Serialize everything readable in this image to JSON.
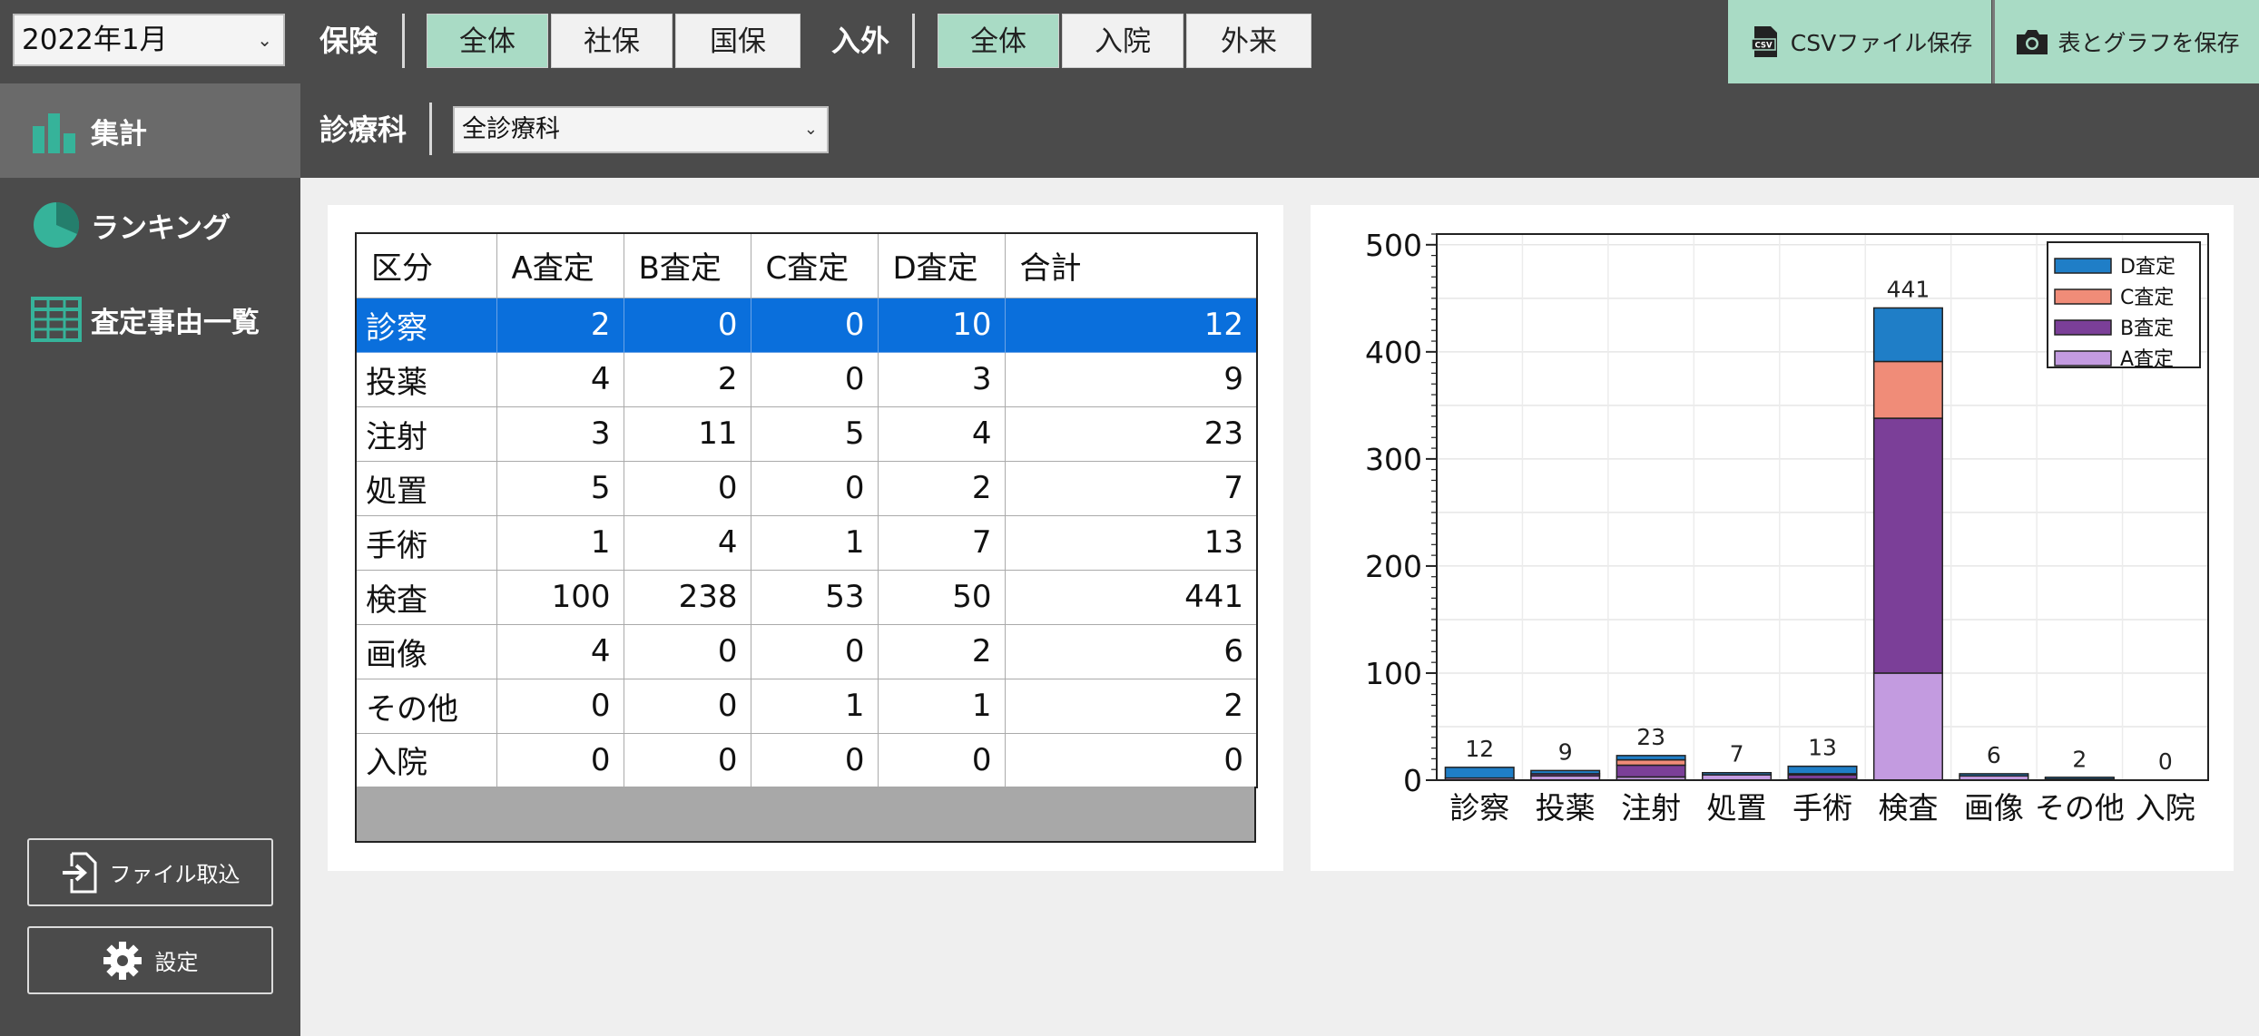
{
  "toolbar": {
    "month_value": "2022年1月",
    "insurance_label": "保険",
    "insurance_options": [
      "全体",
      "社保",
      "国保"
    ],
    "inout_label": "入外",
    "inout_options": [
      "全体",
      "入院",
      "外来"
    ],
    "csv_save_label": "CSVファイル保存",
    "csv_icon_text": "CSV",
    "save_table_graph_label": "表とグラフを保存"
  },
  "filter": {
    "dept_label": "診療科",
    "dept_value": "全診療科"
  },
  "sidebar": {
    "items": [
      {
        "label": "集計"
      },
      {
        "label": "ランキング"
      },
      {
        "label": "査定事由一覧"
      }
    ],
    "import_label": "ファイル取込",
    "settings_label": "設定"
  },
  "table": {
    "headers": [
      "区分",
      "A査定",
      "B査定",
      "C査定",
      "D査定",
      "合計"
    ],
    "rows": [
      {
        "cat": "診察",
        "a": "2",
        "b": "0",
        "c": "0",
        "d": "10",
        "total": "12"
      },
      {
        "cat": "投薬",
        "a": "4",
        "b": "2",
        "c": "0",
        "d": "3",
        "total": "9"
      },
      {
        "cat": "注射",
        "a": "3",
        "b": "11",
        "c": "5",
        "d": "4",
        "total": "23"
      },
      {
        "cat": "処置",
        "a": "5",
        "b": "0",
        "c": "0",
        "d": "2",
        "total": "7"
      },
      {
        "cat": "手術",
        "a": "1",
        "b": "4",
        "c": "1",
        "d": "7",
        "total": "13"
      },
      {
        "cat": "検査",
        "a": "100",
        "b": "238",
        "c": "53",
        "d": "50",
        "total": "441"
      },
      {
        "cat": "画像",
        "a": "4",
        "b": "0",
        "c": "0",
        "d": "2",
        "total": "6"
      },
      {
        "cat": "その他",
        "a": "0",
        "b": "0",
        "c": "1",
        "d": "1",
        "total": "2"
      },
      {
        "cat": "入院",
        "a": "0",
        "b": "0",
        "c": "0",
        "d": "0",
        "total": "0"
      }
    ]
  },
  "chart_data": {
    "type": "bar",
    "stacked": true,
    "categories": [
      "診察",
      "投薬",
      "注射",
      "処置",
      "手術",
      "検査",
      "画像",
      "その他",
      "入院"
    ],
    "series": [
      {
        "name": "A査定",
        "values": [
          2,
          4,
          3,
          5,
          1,
          100,
          4,
          0,
          0
        ],
        "color": "#c39be0"
      },
      {
        "name": "B査定",
        "values": [
          0,
          2,
          11,
          0,
          4,
          238,
          0,
          0,
          0
        ],
        "color": "#7b3f98"
      },
      {
        "name": "C査定",
        "values": [
          0,
          0,
          5,
          0,
          1,
          53,
          0,
          1,
          0
        ],
        "color": "#f08c78"
      },
      {
        "name": "D査定",
        "values": [
          10,
          3,
          4,
          2,
          7,
          50,
          2,
          1,
          0
        ],
        "color": "#1f7ec7"
      }
    ],
    "totals": [
      12,
      9,
      23,
      7,
      13,
      441,
      6,
      2,
      0
    ],
    "ylim": [
      0,
      510
    ],
    "yticks": [
      0,
      100,
      200,
      300,
      400,
      500
    ],
    "grid": true,
    "legend_position": "top-right",
    "legend_order": [
      "D査定",
      "C査定",
      "B査定",
      "A査定"
    ]
  }
}
